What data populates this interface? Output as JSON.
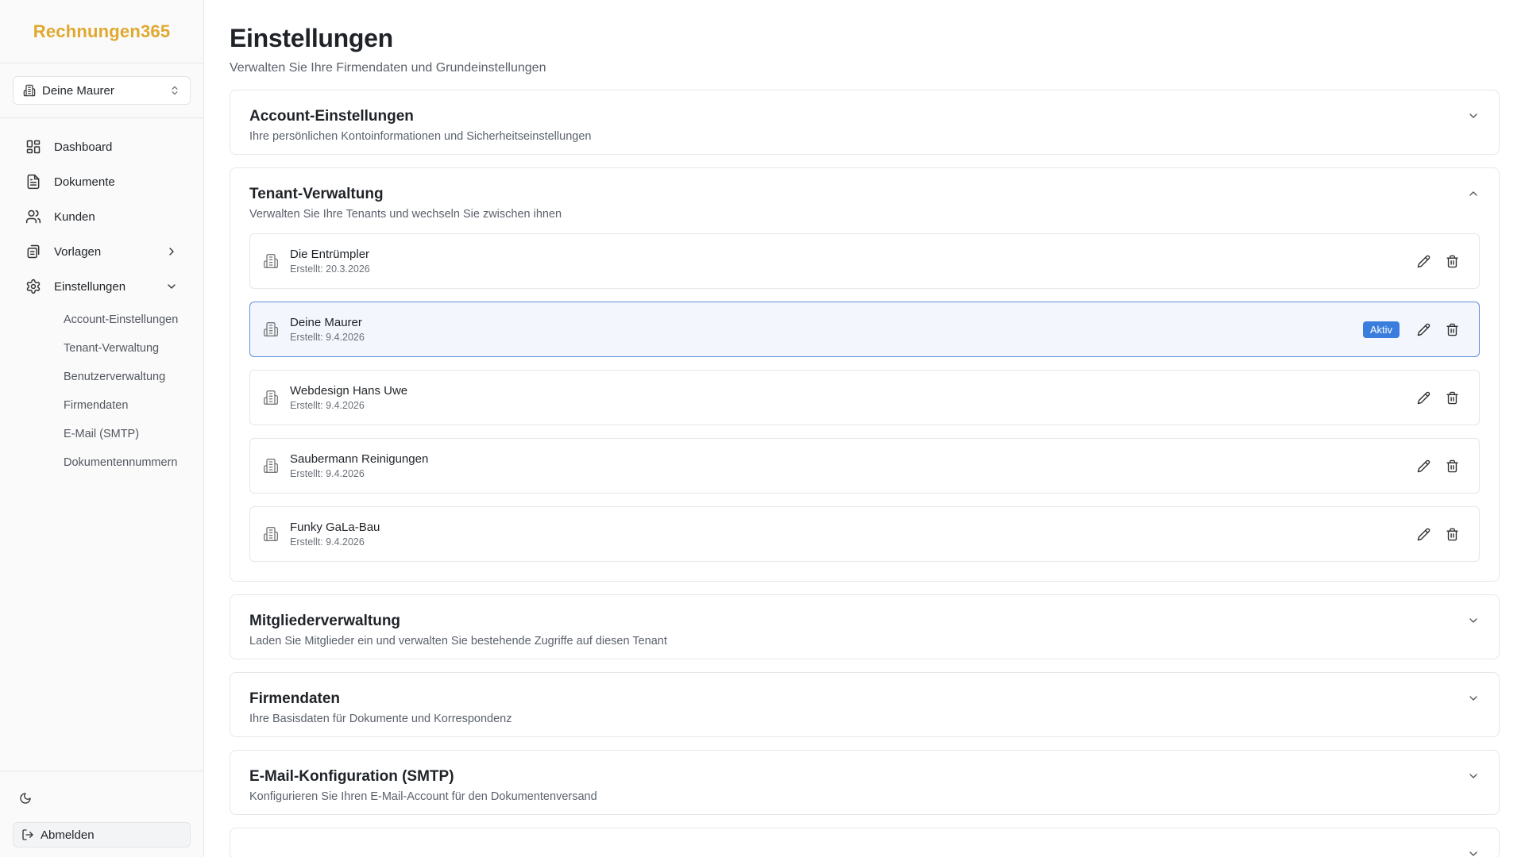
{
  "app": {
    "brand": "Rechnungen365"
  },
  "tenant_switcher": {
    "current": "Deine Maurer"
  },
  "nav": {
    "items": [
      {
        "label": "Dashboard"
      },
      {
        "label": "Dokumente"
      },
      {
        "label": "Kunden"
      },
      {
        "label": "Vorlagen"
      },
      {
        "label": "Einstellungen"
      }
    ],
    "sub_items": [
      {
        "label": "Account-Einstellungen"
      },
      {
        "label": "Tenant-Verwaltung"
      },
      {
        "label": "Benutzerverwaltung"
      },
      {
        "label": "Firmendaten"
      },
      {
        "label": "E-Mail (SMTP)"
      },
      {
        "label": "Dokumentennummern"
      }
    ]
  },
  "sidebar_footer": {
    "logout_label": "Abmelden"
  },
  "page": {
    "title": "Einstellungen",
    "subtitle": "Verwalten Sie Ihre Firmendaten und Grundeinstellungen"
  },
  "sections": {
    "account": {
      "title": "Account-Einstellungen",
      "description": "Ihre persönlichen Kontoinformationen und Sicherheitseinstellungen"
    },
    "tenants": {
      "title": "Tenant-Verwaltung",
      "description": "Verwalten Sie Ihre Tenants und wechseln Sie zwischen ihnen",
      "active_badge": "Aktiv",
      "rows": [
        {
          "name": "Die Entrümpler",
          "created": "Erstellt: 20.3.2026",
          "active": false
        },
        {
          "name": "Deine Maurer",
          "created": "Erstellt: 9.4.2026",
          "active": true
        },
        {
          "name": "Webdesign Hans Uwe",
          "created": "Erstellt: 9.4.2026",
          "active": false
        },
        {
          "name": "Saubermann Reinigungen",
          "created": "Erstellt: 9.4.2026",
          "active": false
        },
        {
          "name": "Funky GaLa-Bau",
          "created": "Erstellt: 9.4.2026",
          "active": false
        }
      ]
    },
    "members": {
      "title": "Mitgliederverwaltung",
      "description": "Laden Sie Mitglieder ein und verwalten Sie bestehende Zugriffe auf diesen Tenant"
    },
    "company": {
      "title": "Firmendaten",
      "description": "Ihre Basisdaten für Dokumente und Korrespondenz"
    },
    "smtp": {
      "title": "E-Mail-Konfiguration (SMTP)",
      "description": "Konfigurieren Sie Ihren E-Mail-Account für den Dokumentenversand"
    }
  },
  "colors": {
    "brand": "#e0a82e",
    "accent": "#3b7ddd",
    "active_row_bg": "#f3f7fd"
  }
}
